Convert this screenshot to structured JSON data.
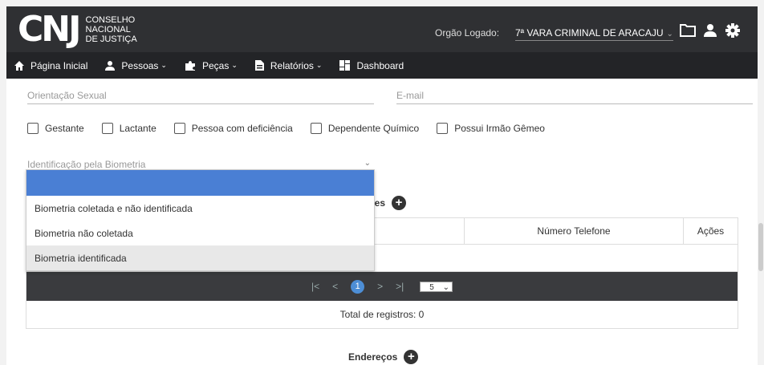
{
  "header": {
    "logo_mark": "CNJ",
    "logo_lines": [
      "CONSELHO",
      "NACIONAL",
      "DE JUSTIÇA"
    ],
    "org_label": "Orgão Logado:",
    "org_value": "7ª VARA CRIMINAL DE ARACAJU"
  },
  "nav": {
    "items": [
      {
        "label": "Página Inicial",
        "icon": "home-icon"
      },
      {
        "label": "Pessoas",
        "icon": "person-icon",
        "has_menu": true
      },
      {
        "label": "Peças",
        "icon": "puzzle-icon",
        "has_menu": true
      },
      {
        "label": "Relatórios",
        "icon": "document-icon",
        "has_menu": true
      },
      {
        "label": "Dashboard",
        "icon": "dashboard-icon"
      }
    ]
  },
  "form": {
    "orientacao_placeholder": "Orientação Sexual",
    "email_placeholder": "E-mail",
    "checkboxes": [
      "Gestante",
      "Lactante",
      "Pessoa com deficiência",
      "Dependente Químico",
      "Possui Irmão Gêmeo"
    ],
    "biometria_placeholder": "Identificação pela Biometria"
  },
  "dropdown": {
    "options": [
      "",
      "Biometria coletada e não identificada",
      "Biometria não coletada",
      "Biometria identificada"
    ],
    "highlighted_index": 3
  },
  "phones": {
    "title_partial": "ones",
    "columns": [
      "",
      "Número Telefone",
      "Ações"
    ],
    "pager": {
      "current_page": "1",
      "page_size": "5"
    },
    "total": "Total de registros: 0"
  },
  "addresses": {
    "title": "Endereços"
  },
  "colors": {
    "header_bg": "#2f3033",
    "nav_bg": "#232427",
    "selected_option": "#4a7fd4",
    "pager_bg": "#3a3b3e",
    "active_page": "#4d8ed6"
  }
}
